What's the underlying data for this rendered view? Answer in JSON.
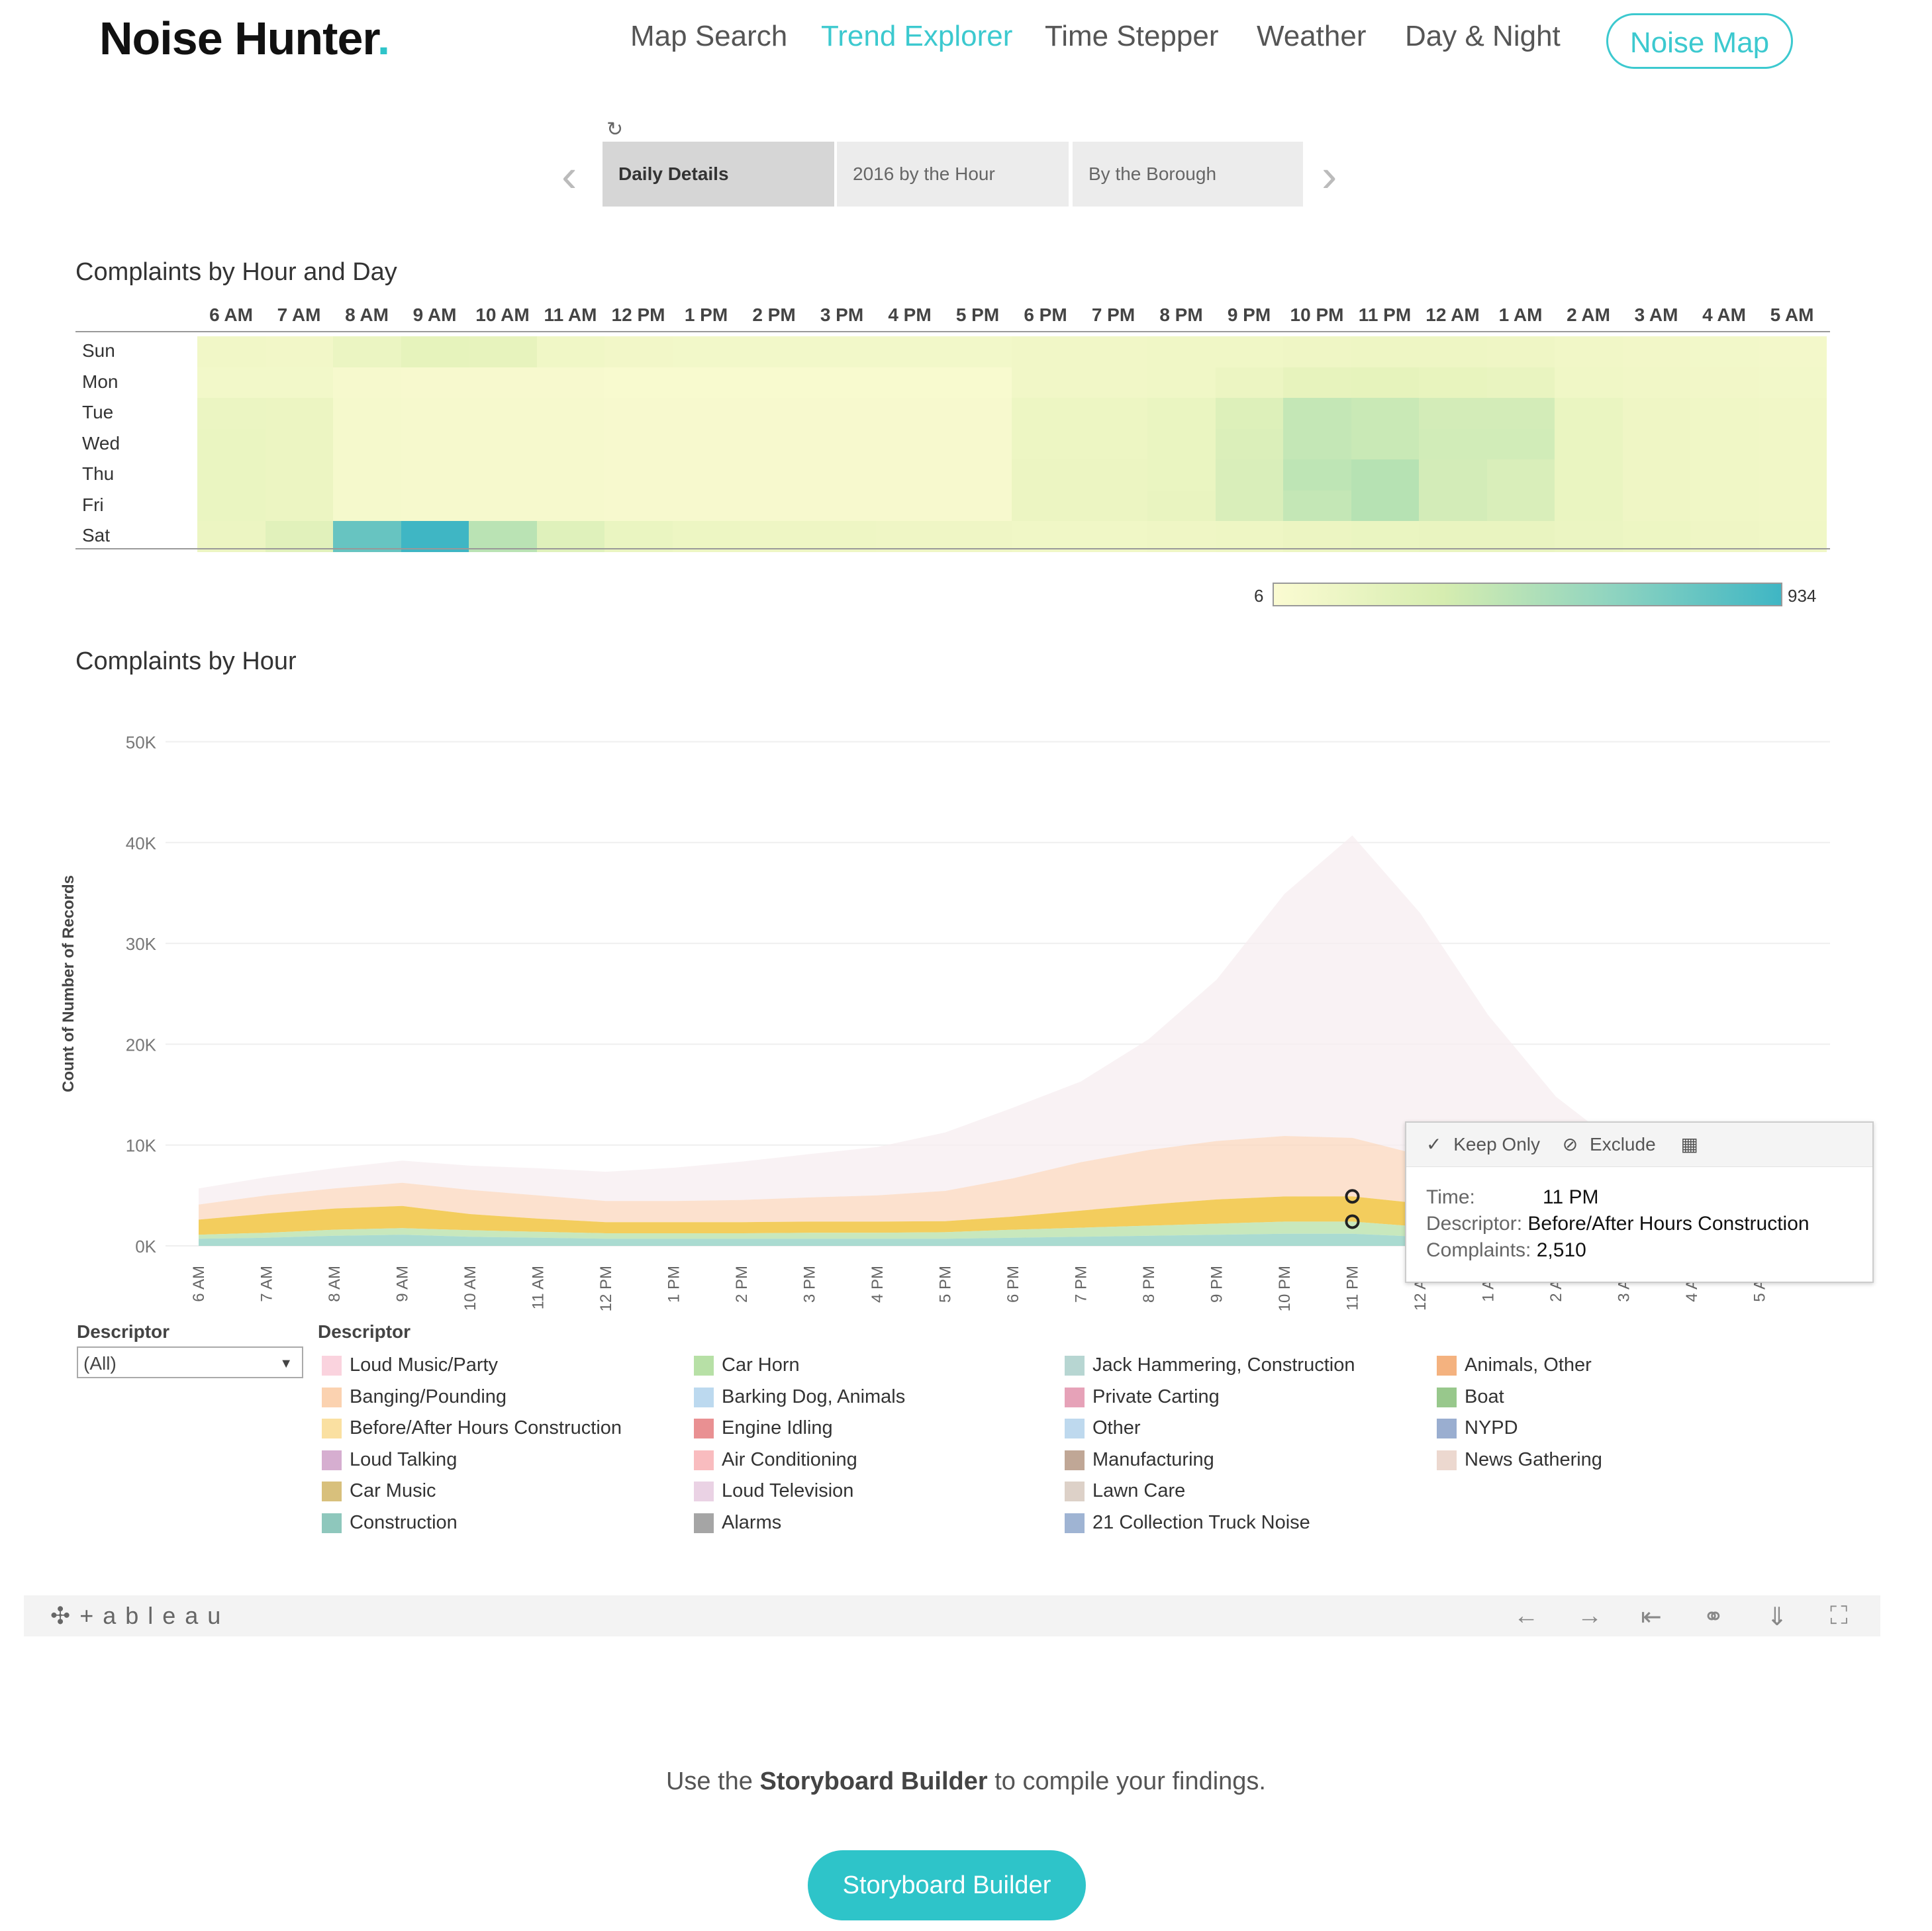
{
  "header": {
    "logo_text": "Noise Hunter",
    "logo_dot": ".",
    "nav": [
      "Map Search",
      "Trend Explorer",
      "Time Stepper",
      "Weather",
      "Day & Night"
    ],
    "active_nav": "Trend Explorer",
    "noise_map_button": "Noise Map"
  },
  "story_tabs": [
    "Daily Details",
    "2016 by the Hour",
    "By the Borough"
  ],
  "heatmap": {
    "title": "Complaints by Hour and Day",
    "hours": [
      "6 AM",
      "7 AM",
      "8 AM",
      "9 AM",
      "10 AM",
      "11 AM",
      "12 PM",
      "1 PM",
      "2 PM",
      "3 PM",
      "4 PM",
      "5 PM",
      "6 PM",
      "7 PM",
      "8 PM",
      "9 PM",
      "10 PM",
      "11 PM",
      "12 AM",
      "1 AM",
      "2 AM",
      "3 AM",
      "4 AM",
      "5 AM"
    ],
    "days": [
      "Sun",
      "Mon",
      "Tue",
      "Wed",
      "Thu",
      "Fri",
      "Sat"
    ],
    "color_min": "6",
    "color_max": "934",
    "colors": {
      "low": "#fbfbd2",
      "high": "#3fb6c4"
    }
  },
  "chart_data": [
    {
      "type": "heatmap",
      "title": "Complaints by Hour and Day",
      "x": [
        "6 AM",
        "7 AM",
        "8 AM",
        "9 AM",
        "10 AM",
        "11 AM",
        "12 PM",
        "1 PM",
        "2 PM",
        "3 PM",
        "4 PM",
        "5 PM",
        "6 PM",
        "7 PM",
        "8 PM",
        "9 PM",
        "10 PM",
        "11 PM",
        "12 AM",
        "1 AM",
        "2 AM",
        "3 AM",
        "4 AM",
        "5 AM"
      ],
      "y": [
        "Sun",
        "Mon",
        "Tue",
        "Wed",
        "Thu",
        "Fri",
        "Sat"
      ],
      "values": [
        [
          120,
          110,
          180,
          240,
          230,
          130,
          110,
          100,
          100,
          100,
          100,
          100,
          120,
          120,
          130,
          130,
          140,
          150,
          150,
          140,
          120,
          110,
          100,
          90
        ],
        [
          100,
          100,
          60,
          50,
          50,
          50,
          40,
          40,
          40,
          40,
          40,
          40,
          120,
          120,
          130,
          170,
          230,
          240,
          220,
          200,
          130,
          120,
          110,
          100
        ],
        [
          180,
          170,
          70,
          60,
          60,
          60,
          50,
          50,
          50,
          50,
          50,
          50,
          160,
          160,
          190,
          280,
          400,
          380,
          330,
          330,
          190,
          140,
          130,
          120
        ],
        [
          190,
          170,
          70,
          60,
          60,
          60,
          50,
          50,
          50,
          50,
          50,
          50,
          160,
          160,
          190,
          290,
          400,
          380,
          340,
          340,
          190,
          140,
          130,
          120
        ],
        [
          190,
          170,
          70,
          60,
          60,
          60,
          50,
          50,
          50,
          50,
          50,
          50,
          170,
          170,
          190,
          300,
          430,
          470,
          330,
          300,
          190,
          140,
          130,
          120
        ],
        [
          190,
          170,
          70,
          60,
          60,
          60,
          50,
          50,
          50,
          50,
          50,
          50,
          170,
          170,
          200,
          300,
          400,
          470,
          330,
          300,
          190,
          140,
          130,
          120
        ],
        [
          170,
          260,
          780,
          934,
          450,
          270,
          190,
          160,
          150,
          150,
          140,
          140,
          130,
          130,
          140,
          150,
          170,
          190,
          200,
          200,
          180,
          160,
          140,
          130
        ]
      ],
      "range": [
        6,
        934
      ]
    },
    {
      "type": "area",
      "title": "Complaints by Hour",
      "xlabel": "",
      "ylabel": "Count of Number of Records",
      "categories": [
        "6 AM",
        "7 AM",
        "8 AM",
        "9 AM",
        "10 AM",
        "11 AM",
        "12 PM",
        "1 PM",
        "2 PM",
        "3 PM",
        "4 PM",
        "5 PM",
        "6 PM",
        "7 PM",
        "8 PM",
        "9 PM",
        "10 PM",
        "11 PM",
        "12 AM",
        "1 AM",
        "2 AM",
        "3 AM",
        "4 AM",
        "5 AM"
      ],
      "ylim": [
        0,
        52000
      ],
      "yticks": [
        "0K",
        "10K",
        "20K",
        "30K",
        "40K",
        "50K"
      ],
      "stacked": true,
      "series": [
        {
          "name": "Construction",
          "color": "#8ecfc1",
          "values": [
            700,
            800,
            1000,
            1100,
            900,
            800,
            700,
            700,
            700,
            700,
            700,
            700,
            800,
            900,
            1000,
            1100,
            1200,
            1200,
            900,
            700,
            500,
            400,
            400,
            500
          ]
        },
        {
          "name": "Car Horn",
          "color": "#b5e0a7",
          "values": [
            400,
            500,
            600,
            650,
            650,
            600,
            550,
            550,
            550,
            600,
            600,
            650,
            800,
            900,
            1000,
            1100,
            1200,
            1200,
            1000,
            800,
            600,
            500,
            400,
            400
          ]
        },
        {
          "name": "Before/After Hours Construction",
          "color": "#f2c84b",
          "values": [
            1500,
            1900,
            2100,
            2200,
            1600,
            1300,
            1100,
            1100,
            1100,
            1100,
            1100,
            1100,
            1300,
            1700,
            2100,
            2400,
            2500,
            2510,
            2300,
            1800,
            1200,
            900,
            800,
            900
          ]
        },
        {
          "name": "Banging/Pounding",
          "color": "#fbd7bd",
          "values": [
            1500,
            1800,
            2000,
            2300,
            2400,
            2300,
            2100,
            2100,
            2200,
            2400,
            2600,
            3000,
            3800,
            4800,
            5400,
            5800,
            6000,
            5800,
            4800,
            3600,
            2500,
            1800,
            1300,
            1200
          ]
        },
        {
          "name": "Loud Music/Party",
          "color": "#f7eef0",
          "values": [
            1600,
            1800,
            2000,
            2200,
            2400,
            2700,
            2900,
            3300,
            3800,
            4300,
            4800,
            5800,
            7000,
            8000,
            11000,
            16000,
            24000,
            30000,
            24000,
            16000,
            10000,
            6000,
            3500,
            2200
          ]
        }
      ],
      "tooltip": {
        "time": "11 PM",
        "descriptor": "Before/After Hours Construction",
        "complaints": "2,510"
      }
    }
  ],
  "area_chart": {
    "title": "Complaints by Hour",
    "ylabel": "Count of Number of Records",
    "yticks": [
      "0K",
      "10K",
      "20K",
      "30K",
      "40K",
      "50K"
    ],
    "xticks": [
      "6 AM",
      "7 AM",
      "8 AM",
      "9 AM",
      "10 AM",
      "11 AM",
      "12 PM",
      "1 PM",
      "2 PM",
      "3 PM",
      "4 PM",
      "5 PM",
      "6 PM",
      "7 PM",
      "8 PM",
      "9 PM",
      "10 PM",
      "11 PM",
      "12 AM",
      "1 AM",
      "2 AM",
      "3 AM",
      "4 AM",
      "5 AM"
    ]
  },
  "tooltip": {
    "keep_only": "Keep Only",
    "exclude": "Exclude",
    "time_label": "Time:",
    "time_value": "11 PM",
    "descriptor_label": "Descriptor:",
    "descriptor_value": "Before/After Hours Construction",
    "complaints_label": "Complaints:",
    "complaints_value": "2,510"
  },
  "filter": {
    "label": "Descriptor",
    "value": "(All)"
  },
  "legend": {
    "title": "Descriptor",
    "items": [
      {
        "label": "Loud Music/Party",
        "color": "#fad3de"
      },
      {
        "label": "Banging/Pounding",
        "color": "#fbd2b0"
      },
      {
        "label": "Before/After Hours Construction",
        "color": "#fae0a1"
      },
      {
        "label": "Loud Talking",
        "color": "#d6aed0"
      },
      {
        "label": "Car Music",
        "color": "#d8c07c"
      },
      {
        "label": "Construction",
        "color": "#8ec7bc"
      },
      {
        "label": "Car Horn",
        "color": "#b7e0a6"
      },
      {
        "label": "Barking Dog, Animals",
        "color": "#bcd9ef"
      },
      {
        "label": "Engine Idling",
        "color": "#e99092"
      },
      {
        "label": "Air Conditioning",
        "color": "#f9bcbf"
      },
      {
        "label": "Loud Television",
        "color": "#ead2e4"
      },
      {
        "label": "Alarms",
        "color": "#a5a5a5"
      },
      {
        "label": "Jack Hammering, Construction",
        "color": "#b7d6d2"
      },
      {
        "label": "Private Carting",
        "color": "#e6a2b8"
      },
      {
        "label": "Other",
        "color": "#bed9ee"
      },
      {
        "label": "Manufacturing",
        "color": "#c0a796"
      },
      {
        "label": "Lawn Care",
        "color": "#ddd1c8"
      },
      {
        "label": "21 Collection Truck Noise",
        "color": "#9fb4d3"
      },
      {
        "label": "Animals, Other",
        "color": "#f4b27f"
      },
      {
        "label": "Boat",
        "color": "#98c88c"
      },
      {
        "label": "NYPD",
        "color": "#9aaed0"
      },
      {
        "label": "News Gathering",
        "color": "#ecd8cf"
      }
    ]
  },
  "tableau": {
    "brand": "+ a b l e a u",
    "icons": [
      "undo-icon",
      "redo-icon",
      "revert-icon",
      "share-icon",
      "download-icon",
      "fullscreen-icon"
    ]
  },
  "footer": {
    "text_before": "Use the ",
    "text_bold": "Storyboard Builder",
    "text_after": " to compile your findings.",
    "button": "Storyboard Builder"
  }
}
